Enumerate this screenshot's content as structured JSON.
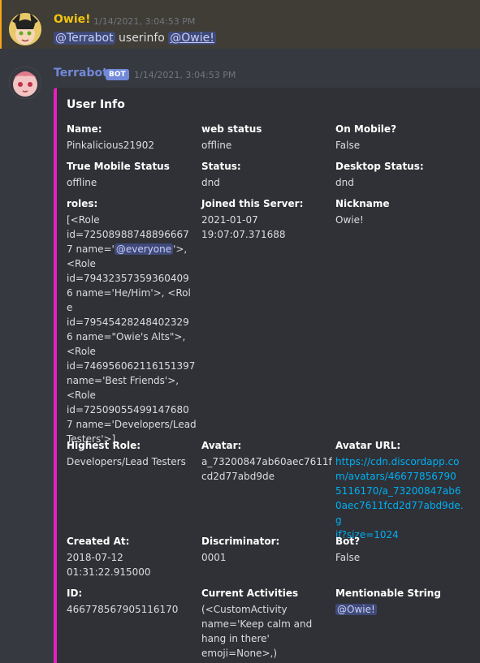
{
  "message1": {
    "author": "Owie!",
    "author_color": "#f1c40f",
    "timestamp": "1/14/2021, 3:04:53 PM",
    "mention_bot": "@Terrabot",
    "command": " userinfo ",
    "mention_user": "@Owie!"
  },
  "message2": {
    "author": "Terrabot",
    "author_color": "#7289da",
    "bot_badge": "BOT",
    "timestamp": "1/14/2021, 3:04:53 PM"
  },
  "embed": {
    "accent_color": "#e91ebd",
    "title": "User Info",
    "fields": [
      {
        "name": "Name:",
        "value": "Pinkalicious21902"
      },
      {
        "name": "web status",
        "value": "offline"
      },
      {
        "name": "On Mobile?",
        "value": "False"
      },
      {
        "name": "True Mobile Status",
        "value": "offline"
      },
      {
        "name": "Status:",
        "value": "dnd"
      },
      {
        "name": "Desktop Status:",
        "value": "dnd"
      },
      {
        "name": "roles:",
        "value_pre": "[<Role\nid=72508988748896667\n7 name='",
        "value_mention": "@everyone",
        "value_post": "'>,\n<Role\nid=79432357359360409\n6 name='He/Him'>, <Role\nid=79545428248402329\n6 name=\"Owie's Alts\">,\n<Role\nid=746956062116151397\nname='Best Friends'>,\n<Role\nid=72509055499147680\n7 name='Developers/Lead\nTesters'>]"
      },
      {
        "name": "Joined this Server:",
        "value": "2021-01-07\n19:07:07.371688"
      },
      {
        "name": "Nickname",
        "value": "Owie!"
      },
      {
        "name": "Highest Role:",
        "value": "Developers/Lead Testers"
      },
      {
        "name": "Avatar:",
        "value": "a_73200847ab60aec7611f\ncd2d77abd9de"
      },
      {
        "name": "Avatar URL:",
        "value": "https://cdn.discordapp.co\nm/avatars/46677856790\n5116170/a_73200847ab6\n0aec7611fcd2d77abd9de.g\nif?size=1024"
      },
      {
        "name": "Created At:",
        "value": "2018-07-12\n01:31:22.915000"
      },
      {
        "name": "Discriminator:",
        "value": "0001"
      },
      {
        "name": "Bot?",
        "value": "False"
      },
      {
        "name": "ID:",
        "value": "466778567905116170"
      },
      {
        "name": "Current Activities",
        "value": "(<CustomActivity\nname='Keep calm and\nhang in there'\nemoji=None>,)"
      },
      {
        "name": "Mentionable String",
        "value": "@Owie!"
      }
    ]
  }
}
